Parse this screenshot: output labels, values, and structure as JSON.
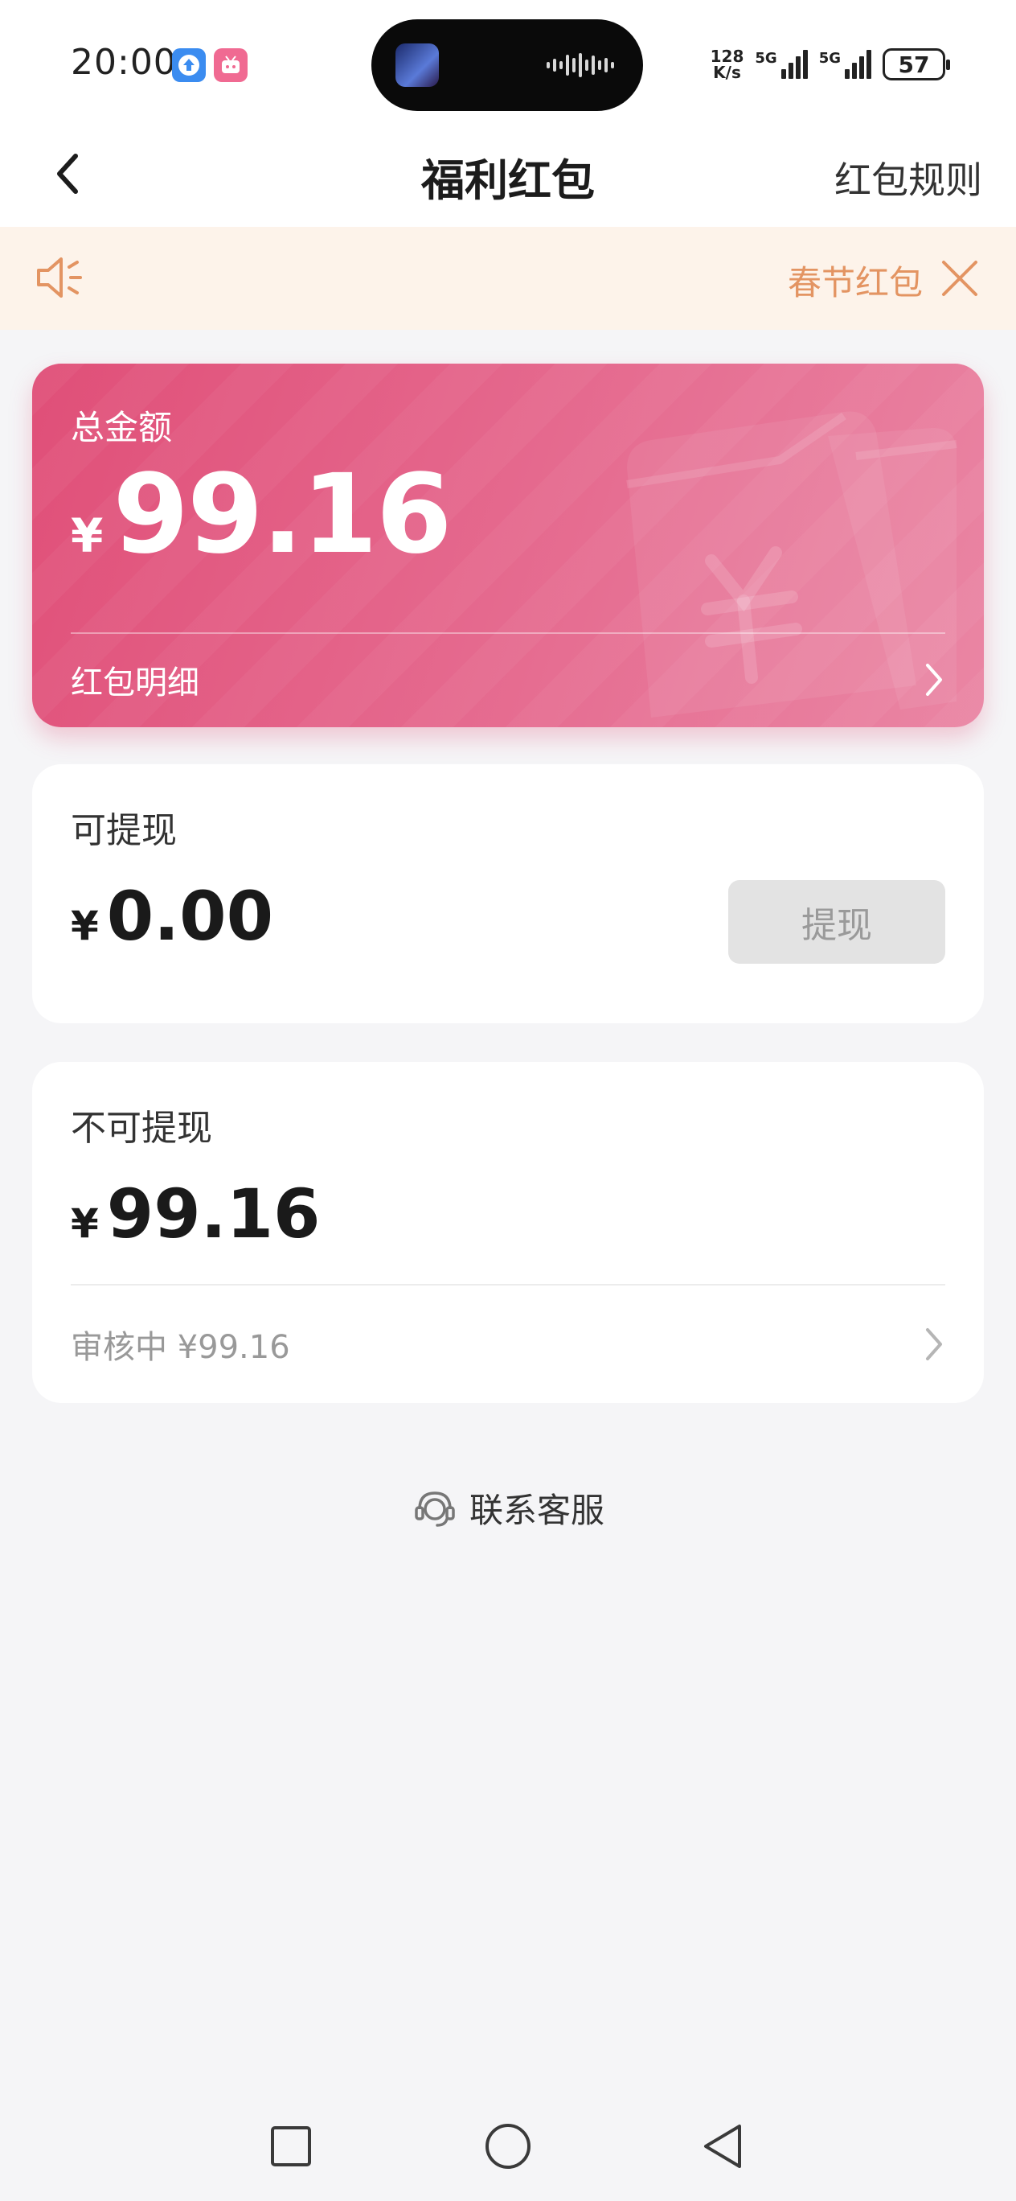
{
  "status_bar": {
    "time": "20:00",
    "net_speed_value": "128",
    "net_speed_unit": "K/s",
    "signal_1_label": "5G",
    "signal_2_label": "5G",
    "battery": "57",
    "icons": [
      "upload-arrow-icon",
      "bilibili-app-icon",
      "album-art-icon",
      "audio-wave-icon",
      "signal-icon",
      "battery-icon"
    ]
  },
  "header": {
    "title": "福利红包",
    "rules_link": "红包规则"
  },
  "notice": {
    "text": "春节红包"
  },
  "total_card": {
    "label": "总金额",
    "currency": "¥",
    "amount": "99.16",
    "detail_label": "红包明细"
  },
  "withdrawable": {
    "label": "可提现",
    "currency": "¥",
    "amount": "0.00",
    "button": "提现"
  },
  "non_withdrawable": {
    "label": "不可提现",
    "currency": "¥",
    "amount": "99.16",
    "review_text": "审核中 ¥99.16"
  },
  "service": {
    "label": "联系客服"
  },
  "colors": {
    "card_gradient_start": "#e04f78",
    "card_gradient_end": "#ea86a4",
    "notice_bg": "#fdf3ea",
    "notice_accent": "#e39462",
    "disabled_button_bg": "#e3e3e3"
  }
}
